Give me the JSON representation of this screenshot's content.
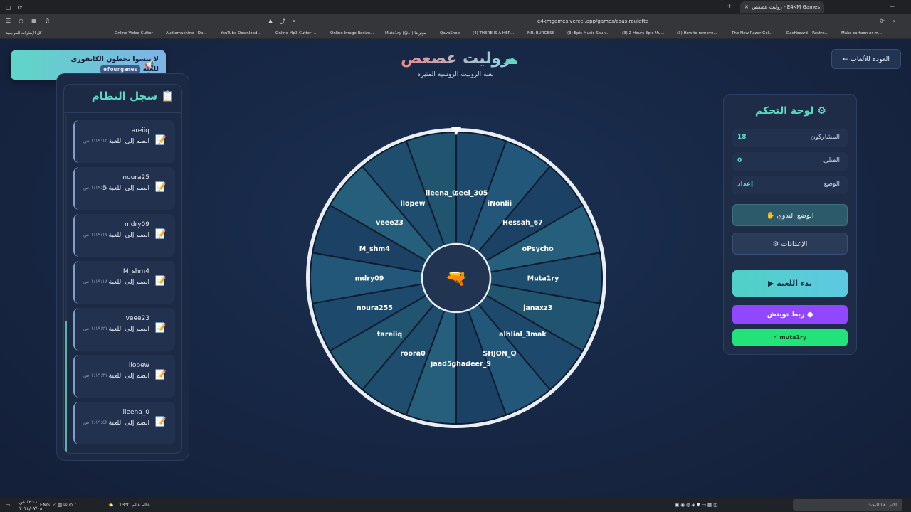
{
  "browser": {
    "tab_title": "روليت عصعص - E4KM Games",
    "url": "e4kmgames.vercel.app/games/asas-roulette",
    "bookmarks": [
      "كل الإشارات المرجعية",
      "Online Video Cutter",
      "Audiomachine - Da...",
      "YouTube Download...",
      "Online Mp3 Cutter -...",
      "Online Image Resize...",
      "Muta1ry (@...) موتريقا",
      "QavaShop",
      "(4) THERE IS A HER...",
      "MR. BURGESS",
      "(3) Epic Music Soun...",
      "(3) 2-Hours Epic Mu...",
      "(3) How to remove...",
      "The New Razer Gol...",
      "Dashboard – Restre...",
      "Make cartoon or m..."
    ]
  },
  "toast": {
    "line1": "لا تنسوا تحطون الكانفوري",
    "line2": "للعبة",
    "code": "efourgames"
  },
  "header": {
    "title": "روليت عصعص",
    "subtitle": "لعبة الروليت الروسية المثيرة",
    "back_button": "← العودة للألعاب"
  },
  "log": {
    "title": "سجل النظام",
    "entries": [
      {
        "name": "tareiiq",
        "message": "انضم إلى اللعبة",
        "time": "١:١٩:١٥ ص"
      },
      {
        "name": "noura25",
        "message": "5 انضم إلى اللعبة",
        "time": "١:١٩:١٧ ص"
      },
      {
        "name": "mdry09",
        "message": "انضم إلى اللعبة",
        "time": "١:١٩:١٧ ص"
      },
      {
        "name": "M_shm4",
        "message": "انضم إلى اللعبة",
        "time": "١:١٩:١٨ ص"
      },
      {
        "name": "veee23",
        "message": "انضم إلى اللعبة",
        "time": "١:١٩:٢١ ص"
      },
      {
        "name": "llopew",
        "message": "انضم إلى اللعبة",
        "time": "١:١٩:٣١ ص"
      },
      {
        "name": "ileena_0",
        "message": "انضم إلى اللعبة",
        "time": "١:١٩:٤٢ ص"
      }
    ]
  },
  "wheel": {
    "players": [
      "seel_305",
      "iNonlii",
      "Hessah_67",
      "oPsycho",
      "Muta1ry",
      "janaxz3",
      "alhlial_3mak",
      "SHJON_Q",
      "ghadeer_9",
      "jaad5",
      "roora0",
      "tareiiq",
      "noura255",
      "mdry09",
      "M_shm4",
      "veee23",
      "llopew",
      "ileena_0"
    ],
    "center_icon": "water-gun-icon"
  },
  "control": {
    "title": "لوحة التحكم",
    "participants_label": "المشاركون:",
    "participants_value": "18",
    "killed_label": "القتلى:",
    "killed_value": "0",
    "mode_label": "الوضع:",
    "mode_value": "إعداد",
    "manual_button": "✋ الوضع اليدوي",
    "settings_button": "⚙ الإعدادات",
    "start_button": "▶ بدء اللعبة",
    "twitch_button": "ربط تويتش",
    "user_button": "⚡ muta1ry"
  },
  "colors": {
    "accent": "#5fd9c4",
    "twitch": "#9146ff",
    "connected": "#22e27a"
  },
  "taskbar": {
    "search_placeholder": "اكتب هنا للبحث",
    "weather": "13°C عالم غائم",
    "language": "ENG",
    "time": "١٢:٠٠ ص",
    "date": "٢٠٢٤/٠٧/٠٨"
  }
}
